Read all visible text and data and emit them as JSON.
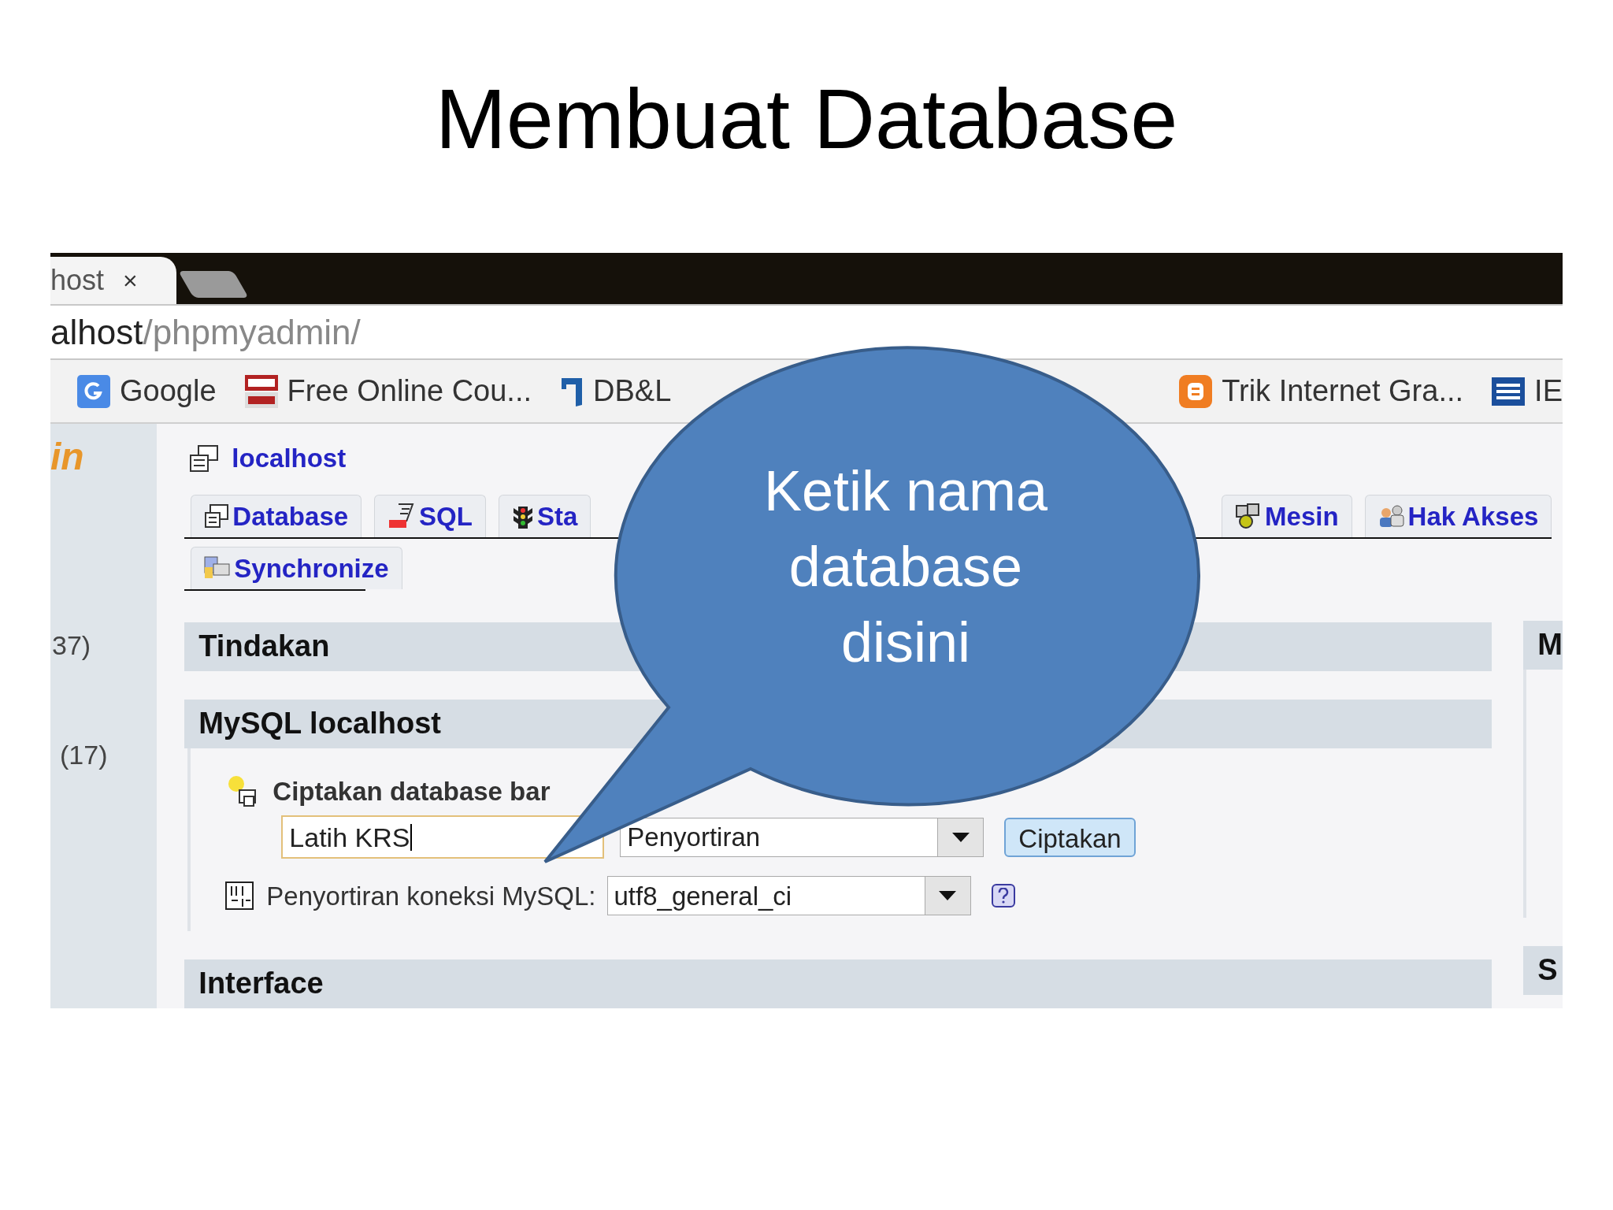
{
  "slide": {
    "title": "Membuat Database"
  },
  "browser": {
    "tab": {
      "label": "host",
      "close": "×"
    },
    "address": {
      "host": "alhost",
      "path": "/phpmyadmin/"
    },
    "bookmarks": [
      {
        "label": "Google"
      },
      {
        "label": "Free Online Cou..."
      },
      {
        "label": "DB&L"
      },
      {
        "label": "Trik Internet Gra..."
      },
      {
        "label": "IE"
      }
    ]
  },
  "sidebar": {
    "logo": "in",
    "items": [
      "37)",
      "(17)"
    ]
  },
  "server": {
    "title": "localhost"
  },
  "tab_rows": [
    [
      {
        "label": "Database"
      },
      {
        "label": "SQL"
      },
      {
        "label": "Sta"
      },
      {
        "label": "Mesin"
      },
      {
        "label": "Hak Akses"
      }
    ],
    [
      {
        "label": "Synchronize"
      }
    ]
  ],
  "sections": [
    {
      "title": "Tindakan"
    },
    {
      "title": "MySQL localhost"
    },
    {
      "title": "Interface"
    }
  ],
  "create_db": {
    "label": "Ciptakan database bar",
    "name_value": "Latih KRS",
    "collation_value": "Penyortiran",
    "button": "Ciptakan"
  },
  "connection": {
    "label": "Penyortiran koneksi MySQL:",
    "value": "utf8_general_ci"
  },
  "right_column": [
    "M",
    "S"
  ],
  "callout": {
    "text": "Ketik nama database disini"
  }
}
